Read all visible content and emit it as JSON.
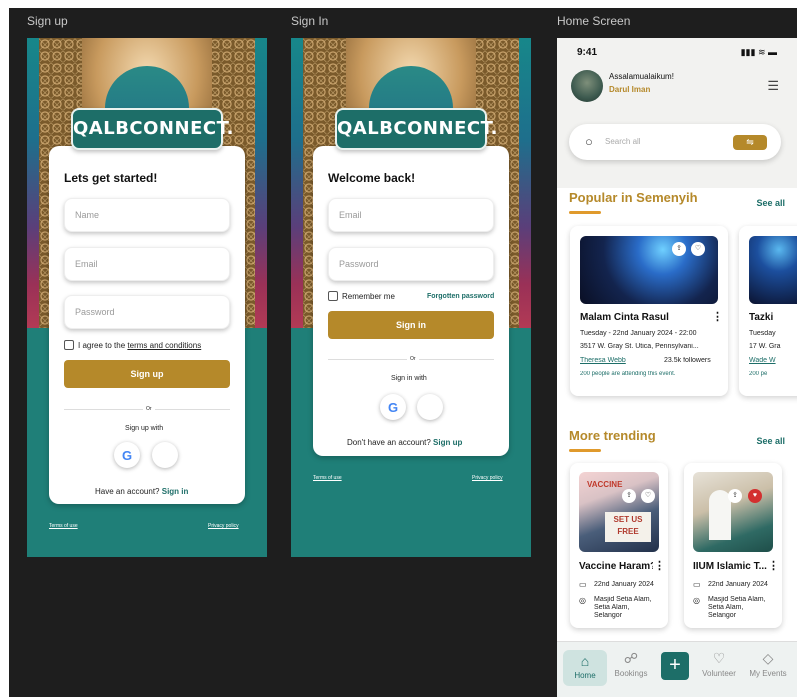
{
  "frames": {
    "signup": "Sign up",
    "signin": "Sign In",
    "home": "Home Screen"
  },
  "signup": {
    "logo": "QALBCONNECT.",
    "title": "Lets get started!",
    "name_ph": "Name",
    "email_ph": "Email",
    "password_ph": "Password",
    "agree_prefix": "I agree to the",
    "agree_link": "terms and conditions",
    "button": "Sign up",
    "or": "Or",
    "with": "Sign up with",
    "have_account": "Have an account?",
    "signin_link": "Sign in",
    "terms": "Terms of use",
    "privacy": "Privacy policy"
  },
  "signin": {
    "logo": "QALBCONNECT.",
    "title": "Welcome back!",
    "email_ph": "Email",
    "password_ph": "Password",
    "remember": "Remember me",
    "forgot": "Forgotten password",
    "button": "Sign in",
    "or": "Or",
    "with": "Sign in with",
    "no_account": "Don't have an account?",
    "signup_link": "Sign up",
    "terms": "Terms of use",
    "privacy": "Privacy policy"
  },
  "home": {
    "time": "9:41",
    "status_icons": "▮▮▮ ≋ ▬",
    "greeting": "Assalamualaikum!",
    "user": "Darul Iman",
    "search_ph": "Search all",
    "popular": "Popular in Semenyih",
    "see_all": "See all",
    "trending": "More trending",
    "event1": {
      "title": "Malam Cinta Rasul",
      "date": "Tuesday - 22nd January 2024 - 22:00",
      "address": "3517 W. Gray St. Utica, Pennsylvani...",
      "host": "Theresa Webb",
      "followers": "23.5k followers",
      "attending": "200 people are attending this event."
    },
    "event2": {
      "title": "Tazki",
      "date": "Tuesday",
      "address": "17 W. Gra",
      "host": "Wade W",
      "attending": "200 pe"
    },
    "trend1": {
      "title": "Vaccine Haram?",
      "date": "22nd January 2024",
      "loc1": "Masjid Setia Alam,",
      "loc2": "Setia Alam,",
      "loc3": "Selangor",
      "sign1": "VACCINE",
      "sign2": "SET US",
      "sign3": "FREE"
    },
    "trend2": {
      "title": "IIUM Islamic T...",
      "date": "22nd January 2024",
      "loc1": "Masjid Setia Alam,",
      "loc2": "Setia Alam,",
      "loc3": "Selangor"
    },
    "tabs": {
      "home": "Home",
      "bookings": "Bookings",
      "volunteer": "Volunteer",
      "events": "My Events"
    }
  }
}
